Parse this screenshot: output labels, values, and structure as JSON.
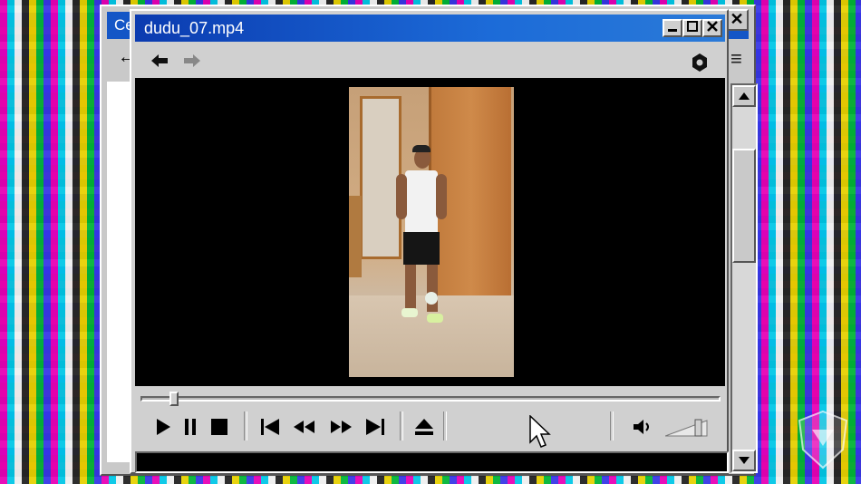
{
  "back_window": {
    "title": "Ce",
    "close_glyph": "✕",
    "menu_icon": "hamburger-icon",
    "back_arrow_icon": "arrow-left-icon"
  },
  "player": {
    "title": "dudu_07.mp4",
    "title_buttons": {
      "minimize": "minimize-icon",
      "maximize": "maximize-icon",
      "close": "close-icon"
    },
    "nav": {
      "back_icon": "arrow-left-icon",
      "forward_icon": "arrow-right-icon",
      "settings_icon": "gear-icon"
    },
    "seek_progress": 0.05,
    "controls": [
      "play-icon",
      "pause-icon",
      "stop-icon",
      "skip-back-icon",
      "rewind-icon",
      "fast-forward-icon",
      "skip-forward-icon",
      "eject-icon",
      "volume-icon"
    ],
    "volume_level": 0.75
  },
  "colors": {
    "title_bar": "#1456c6",
    "window_face": "#d0d0d0",
    "video_bg": "#000000"
  }
}
